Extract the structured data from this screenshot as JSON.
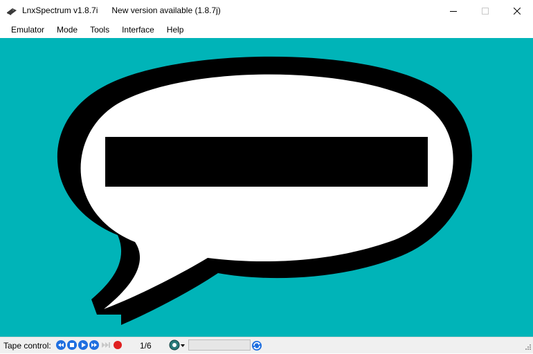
{
  "window": {
    "title": "LnxSpectrum v1.8.7i      New version available (1.8.7j)",
    "controls": [
      "minimize-icon",
      "maximize-icon",
      "close-icon"
    ]
  },
  "menu": {
    "items": [
      {
        "label": "Emulator"
      },
      {
        "label": "Mode"
      },
      {
        "label": "Tools"
      },
      {
        "label": "Interface"
      },
      {
        "label": "Help"
      }
    ]
  },
  "screen": {
    "background": "#00b4b8",
    "graphic": "speech-bubble-icon"
  },
  "status": {
    "tape_label": "Tape control:",
    "tape_buttons": [
      "rewind-icon",
      "stop-icon",
      "play-icon",
      "fast-forward-icon",
      "skip-icon",
      "record-icon"
    ],
    "tape_position": "1/6",
    "tape_progress": 0,
    "colors": {
      "button_blue": "#1f6fe0",
      "record_red": "#e02020"
    }
  }
}
